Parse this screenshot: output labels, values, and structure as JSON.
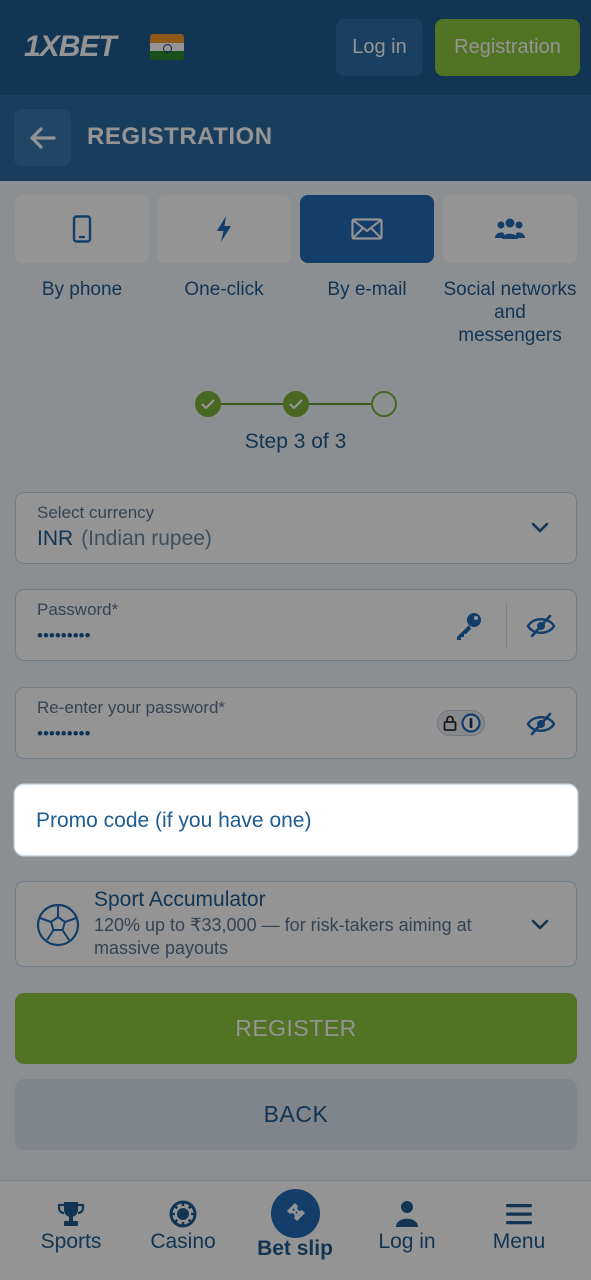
{
  "header": {
    "logo": "1XBET",
    "login_label": "Log in",
    "register_label": "Registration"
  },
  "subheader": {
    "title": "REGISTRATION"
  },
  "methods": [
    {
      "label": "By phone",
      "icon": "phone-icon"
    },
    {
      "label": "One-click",
      "icon": "lightning-icon"
    },
    {
      "label": "By e-mail",
      "icon": "envelope-icon"
    },
    {
      "label": "Social networks and messengers",
      "icon": "users-icon"
    }
  ],
  "stepper": {
    "text": "Step 3 of 3",
    "current": 3,
    "total": 3
  },
  "currency": {
    "label": "Select currency",
    "code": "INR",
    "name": "(Indian rupee)"
  },
  "password": {
    "label": "Password*",
    "value": "•••••••••"
  },
  "repassword": {
    "label": "Re-enter your password*",
    "value": "•••••••••"
  },
  "promo": {
    "placeholder": "Promo code (if you have one)"
  },
  "bonus": {
    "title": "Sport Accumulator",
    "description": "120% up to ₹33,000 — for risk-takers aiming at massive payouts"
  },
  "actions": {
    "register_label": "REGISTER",
    "back_label": "BACK"
  },
  "bottom_nav": [
    {
      "label": "Sports",
      "icon": "trophy-icon"
    },
    {
      "label": "Casino",
      "icon": "casino-chip-icon"
    },
    {
      "label": "Bet slip",
      "icon": "ticket-icon"
    },
    {
      "label": "Log in",
      "icon": "user-icon"
    },
    {
      "label": "Menu",
      "icon": "hamburger-icon"
    }
  ],
  "colors": {
    "brand_blue": "#1f5c91",
    "accent_green": "#8cc63f",
    "active_blue": "#1f6cb5"
  }
}
